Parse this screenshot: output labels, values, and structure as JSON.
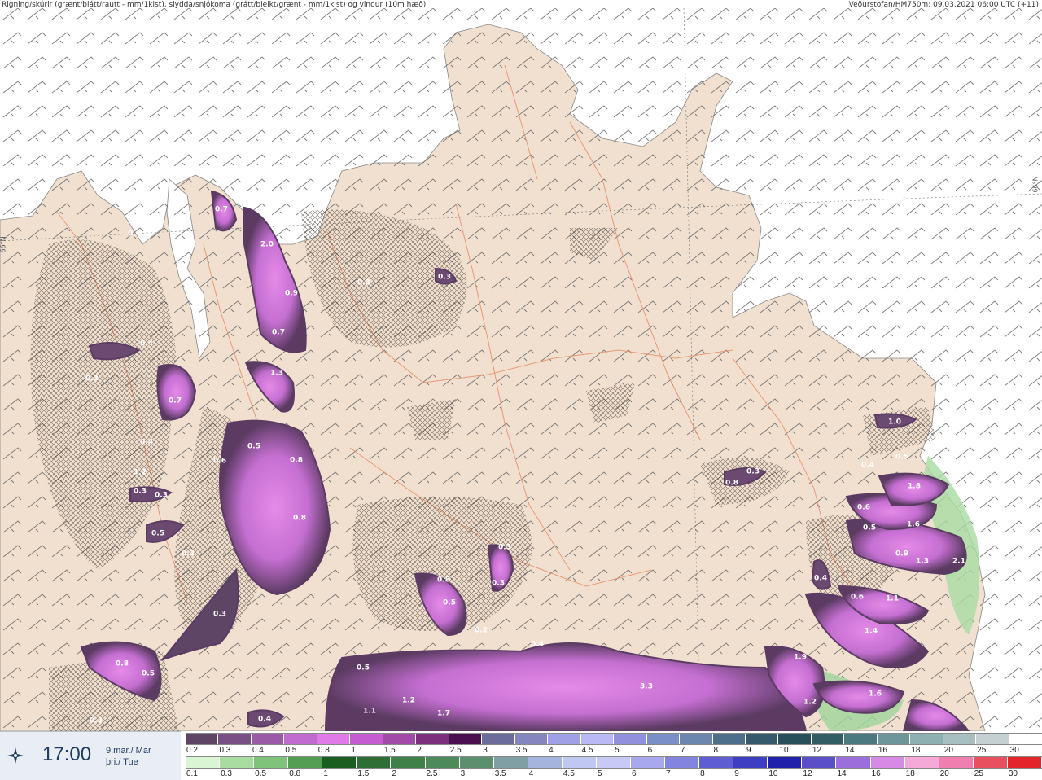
{
  "header": {
    "title": "Rigning/skúrir (grænt/blátt/rautt - mm/1klst), slydda/snjókoma (grátt/bleikt/grænt - mm/1klst) og vindur (10m hæð)",
    "source": "Veðurstofan/HM750m: 09.03.2021 06:00 UTC (+11)"
  },
  "grid": {
    "lat_label": "66°N"
  },
  "time_panel": {
    "icon": "wind-compass-icon",
    "time": "17:00",
    "date_line1": "9.mar./ Mar",
    "date_line2": "þri./ Tue"
  },
  "legend_snow": {
    "values": [
      "0.2",
      "0.3",
      "0.4",
      "0.5",
      "0.8",
      "1",
      "1.5",
      "2",
      "2.5",
      "3",
      "3.5",
      "4",
      "4.5",
      "5",
      "6",
      "7",
      "8",
      "9",
      "10",
      "12",
      "14",
      "16",
      "18",
      "20",
      "25",
      "30"
    ],
    "colors": [
      "#5e4565",
      "#7a4f86",
      "#9b5aa6",
      "#c16ad0",
      "#e07ae8",
      "#c55cd0",
      "#a14aa8",
      "#7c2f7c",
      "#4b0e4f",
      "#6c6c9c",
      "#8585c0",
      "#a0a0e6",
      "#b9b9f5",
      "#9090dd",
      "#7a8fc5",
      "#6b87b0",
      "#4d6f8c",
      "#355a6c",
      "#27505a",
      "#305e64",
      "#4a7a80",
      "#6c969a",
      "#8fb0b2",
      "#a8bfc0",
      "#c5d0d2",
      "#ffffff"
    ]
  },
  "legend_rain": {
    "values": [
      "0.1",
      "0.3",
      "0.5",
      "0.8",
      "1",
      "1.5",
      "2",
      "2.5",
      "3",
      "3.5",
      "4",
      "4.5",
      "5",
      "6",
      "7",
      "8",
      "9",
      "10",
      "12",
      "14",
      "16",
      "18",
      "20",
      "25",
      "30"
    ],
    "colors": [
      "#d9f5d4",
      "#a8dca0",
      "#7fc27a",
      "#529e52",
      "#1c5e22",
      "#2f6f36",
      "#3f7f48",
      "#4d8a5a",
      "#5c8f6e",
      "#7f9fa5",
      "#a4b4dc",
      "#c0c8f2",
      "#c9c9f6",
      "#a8a8ef",
      "#8383e0",
      "#5e5ed2",
      "#3e3ec2",
      "#2020aa",
      "#5a4fc6",
      "#9a6edb",
      "#d68ae6",
      "#f4a9d8",
      "#f07fb0",
      "#e8505f",
      "#e3242a"
    ]
  },
  "precip_labels": [
    "0.7",
    "2.0",
    "0.9",
    "0.7",
    "1.3",
    "0.4",
    "0.7",
    "0.5",
    "0.6",
    "0.8",
    "0.8",
    "0.4",
    "1.2",
    "0.3",
    "0.3",
    "0.5",
    "0.3",
    "0.3",
    "0.8",
    "0.5",
    "0.2",
    "0.4",
    "0.3",
    "0.3",
    "0.8",
    "0.5",
    "0.5",
    "0.2",
    "0.4",
    "0.3",
    "3.3",
    "1.2",
    "1.1",
    "1.7",
    "0.8",
    "1.9",
    "1.2",
    "1.6",
    "1.4",
    "0.6",
    "1.1",
    "0.4",
    "0.9",
    "1.3",
    "2.1",
    "0.6",
    "0.5",
    "1.8",
    "1.6",
    "0.4",
    "0.5",
    "1.0",
    "0.3",
    "0.3",
    "0.4",
    "0.3"
  ]
}
